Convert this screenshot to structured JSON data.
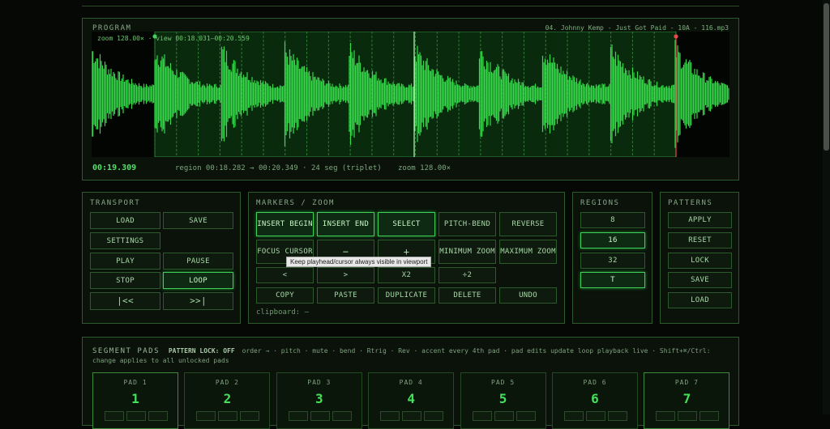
{
  "program": {
    "title": "PROGRAM",
    "track": "04. Johnny Kemp - Just Got Paid - 10A - 116.mp3",
    "zoom_view": "zoom 128.00× · view 00:18.031–00:20.559",
    "time": "00:19.309",
    "region_info": "region 00:18.282 → 00:20.349 · 24 seg (triplet)",
    "zoom_info": "zoom 128.00×"
  },
  "transport": {
    "title": "TRANSPORT",
    "buttons": [
      "LOAD",
      "SAVE",
      "SETTINGS",
      "PLAY",
      "PAUSE",
      "STOP",
      "LOOP",
      "|<<",
      ">>|"
    ]
  },
  "markers": {
    "title": "MARKERS / ZOOM",
    "row1": [
      "INSERT BEGIN",
      "INSERT END",
      "SELECT",
      "PITCH-BEND",
      "REVERSE"
    ],
    "row2": [
      "FOCUS CURSOR",
      "−",
      "+",
      "MINIMUM ZOOM",
      "MAXIMUM ZOOM"
    ],
    "row3": [
      "<",
      ">",
      "X2",
      "÷2"
    ],
    "row4": [
      "COPY",
      "PASTE",
      "DUPLICATE",
      "DELETE",
      "UNDO"
    ],
    "tooltip": "Keep playhead/cursor always visible in viewport",
    "clipboard": "clipboard: —"
  },
  "regions": {
    "title": "REGIONS",
    "buttons": [
      "8",
      "16",
      "32",
      "T"
    ]
  },
  "patterns": {
    "title": "PATTERNS",
    "buttons": [
      "APPLY",
      "RESET",
      "LOCK",
      "SAVE",
      "LOAD"
    ]
  },
  "segment_pads": {
    "title": "SEGMENT PADS",
    "lock_label": "PATTERN LOCK: OFF",
    "info": "order → · pitch · mute · bend · Rtrig · Rev · accent every 4th pad · pad edits update loop playback live · Shift+⌘/Ctrl: change applies to all unlocked pads",
    "pads": [
      {
        "label": "PAD 1",
        "num": "1"
      },
      {
        "label": "PAD 2",
        "num": "2"
      },
      {
        "label": "PAD 3",
        "num": "3"
      },
      {
        "label": "PAD 4",
        "num": "4"
      },
      {
        "label": "PAD 5",
        "num": "5"
      },
      {
        "label": "PAD 6",
        "num": "6"
      },
      {
        "label": "PAD 7",
        "num": "7"
      }
    ]
  },
  "colors": {
    "accent": "#3fd05a",
    "wave": "#39e34d",
    "bg": "#050805",
    "marker": "#e84a4a"
  }
}
